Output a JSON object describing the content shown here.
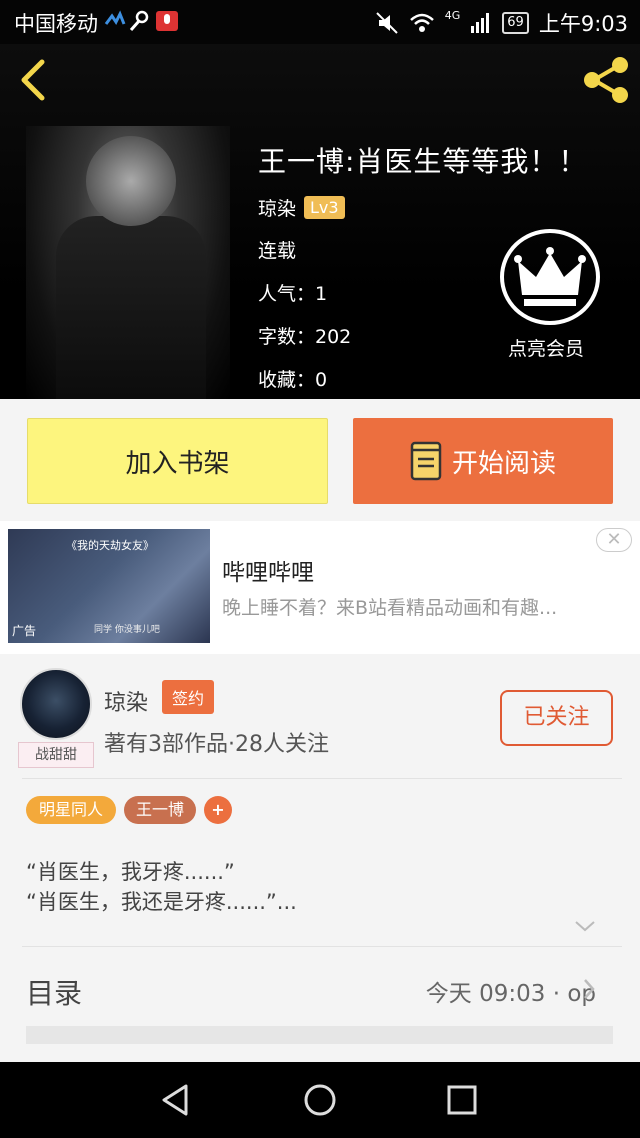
{
  "statusbar": {
    "carrier": "中国移动",
    "network": "4G",
    "battery": "69",
    "time": "上午9:03"
  },
  "book": {
    "title": "王一博:肖医生等等我！！",
    "author": "琼染",
    "level": "Lv3",
    "status": "连载",
    "popularity": "人气：1",
    "wordcount": "字数：202",
    "favorites": "收藏：0"
  },
  "vip": {
    "label": "点亮会员"
  },
  "actions": {
    "add_shelf": "加入书架",
    "start_read": "开始阅读"
  },
  "ad": {
    "image_title": "《我的天劫女友》",
    "image_badge": "广告",
    "image_subtitle": "同学 你没事儿吧",
    "title": "哔哩哔哩",
    "desc": "晚上睡不着？来B站看精品动画和有趣..."
  },
  "author_card": {
    "avatar_tag": "战甜甜",
    "name": "琼染",
    "sign_badge": "签约",
    "stats": "著有3部作品·28人关注",
    "follow": "已关注"
  },
  "tags": [
    "明星同人",
    "王一博",
    "+"
  ],
  "intro": {
    "line1": "“肖医生，我牙疼......”",
    "line2": "“肖医生，我还是牙疼......”..."
  },
  "toc": {
    "label": "目录",
    "latest": "今天 09:03 · op"
  },
  "colors": {
    "accent": "#ec6f3f",
    "add_button": "#fdf57e",
    "level_badge": "#f0bd55",
    "tag_orange": "#f3a93b",
    "tag_brown": "#c8704f"
  }
}
